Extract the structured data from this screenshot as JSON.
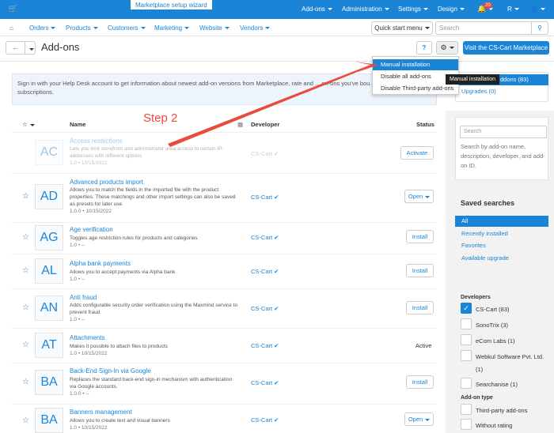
{
  "topbar": {
    "wizard": "Marketplace setup wizard",
    "addons": "Add-ons",
    "administration": "Administration",
    "settings": "Settings",
    "design": "Design",
    "notif_count": "20",
    "lang": "R"
  },
  "secnav": {
    "orders": "Orders",
    "products": "Products",
    "customers": "Customers",
    "marketing": "Marketing",
    "website": "Website",
    "vendors": "Vendors",
    "quick_start": "Quick start menu",
    "search_placeholder": "Search"
  },
  "header": {
    "title": "Add-ons",
    "marketplace_btn": "Visit the CS-Cart Marketplace"
  },
  "dropdown": {
    "items": [
      "Manual installation",
      "Disable all add-ons",
      "Disable Third-party add-ons"
    ]
  },
  "tooltip": "Manual installation",
  "info": "Sign in with your Help Desk account to get information about newest add-on versions from Marketplace, rate and ... on-ons you've bou... prolong your license subscriptions.",
  "side_tabs": {
    "installed": "ddons (83)",
    "upgrades": "Upgrades (0)"
  },
  "step": "Step 2",
  "table": {
    "name_header": "Name",
    "dev_header": "Developer",
    "status_header": "Status",
    "rows": [
      {
        "abbr": "AC",
        "name": "Access restrictions",
        "desc": "Lets you limit storefront and administrator area access to certain IP-addresses with different options",
        "version": "1.0 • 10/15/2022",
        "dev": "CS-Cart",
        "action": "Activate"
      },
      {
        "abbr": "AD",
        "name": "Advanced products import",
        "desc": "Allows you to match the fields in the imported file with the product properties. These matchings and other import settings can also be saved as presets for later use.",
        "version": "1.0.0 • 10/15/2022",
        "dev": "CS-Cart",
        "action": "Open"
      },
      {
        "abbr": "AG",
        "name": "Age verification",
        "desc": "Toggles age restriction rules for products and categories",
        "version": "1.0 • --",
        "dev": "CS-Cart",
        "action": "Install"
      },
      {
        "abbr": "AL",
        "name": "Alpha bank payments",
        "desc": "Allows you to accept payments via Alpha bank",
        "version": "1.0 • --",
        "dev": "CS-Cart",
        "action": "Install"
      },
      {
        "abbr": "AN",
        "name": "Anti fraud",
        "desc": "Adds configurable security order verification using the Maxmind service to prevent fraud",
        "version": "1.0 • --",
        "dev": "CS-Cart",
        "action": "Install"
      },
      {
        "abbr": "AT",
        "name": "Attachments",
        "desc": "Makes it possible to attach files to products",
        "version": "1.0 • 10/15/2022",
        "dev": "CS-Cart",
        "action": "Active"
      },
      {
        "abbr": "BA",
        "name": "Back-End Sign-In via Google",
        "desc": "Replaces the standard back-end sign-in mechanism with authentication via Google accounts.",
        "version": "1.0.0 • --",
        "dev": "CS-Cart",
        "action": "Install"
      },
      {
        "abbr": "BA",
        "name": "Banners management",
        "desc": "Allows you to create text and visual banners",
        "version": "1.0 • 10/15/2022",
        "dev": "CS-Cart",
        "action": "Open"
      }
    ]
  },
  "search_panel": {
    "placeholder": "Search",
    "hint": "Search by add-on name, description, developer, and add-on ID."
  },
  "saved_searches": {
    "title": "Saved searches",
    "items": [
      "All",
      "Recently installed",
      "Favorites",
      "Available upgrade"
    ]
  },
  "developers": {
    "title": "Developers",
    "items": [
      "CS-Cart (83)",
      "SonoTrix (3)",
      "eCom Labs (1)",
      "Webkul Software Pvt. Ltd.",
      "(1)",
      "Searchanise (1)"
    ]
  },
  "addon_type": {
    "title": "Add-on type",
    "items": [
      "Third-party add-ons",
      "Without rating"
    ]
  },
  "colors": {
    "accent": "#1a84d6",
    "annotation": "#e74c3c"
  }
}
